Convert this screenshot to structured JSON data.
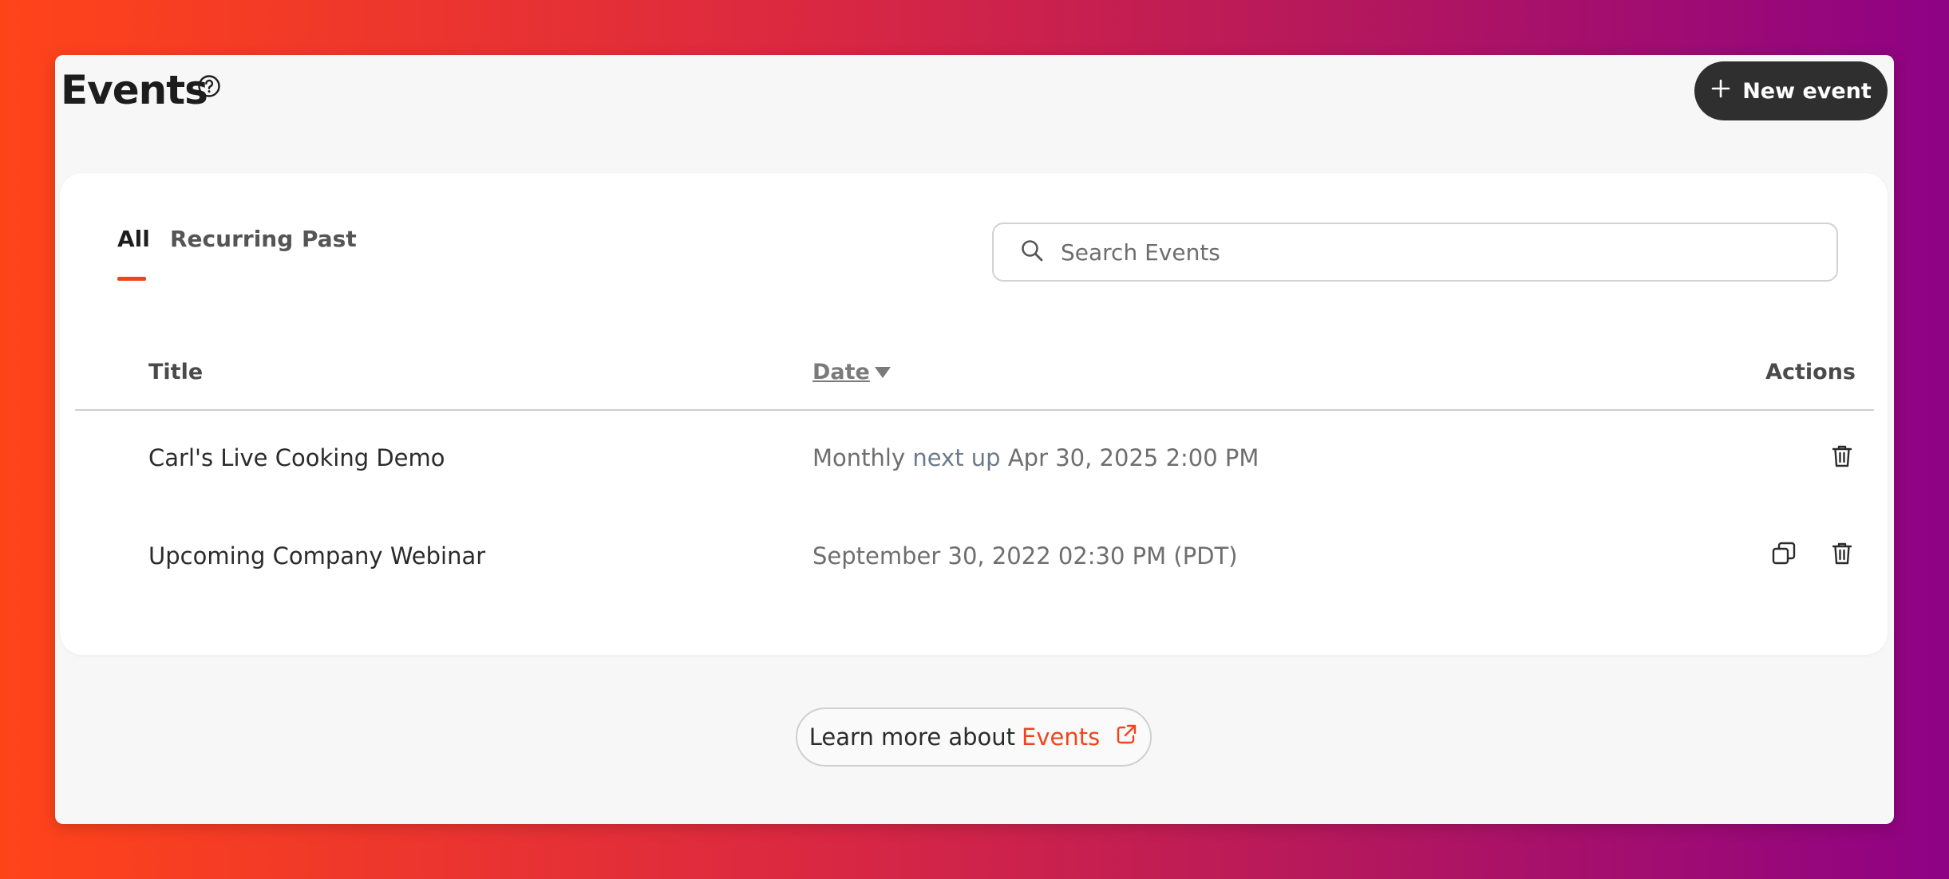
{
  "page": {
    "title": "Events"
  },
  "toolbar": {
    "new_event_label": "New event"
  },
  "tabs": [
    {
      "label": "All",
      "active": true
    },
    {
      "label": "Recurring",
      "active": false
    },
    {
      "label": "Past",
      "active": false
    }
  ],
  "search": {
    "placeholder": "Search Events",
    "value": ""
  },
  "table": {
    "columns": {
      "title": "Title",
      "date": "Date",
      "actions": "Actions"
    },
    "sort": {
      "column": "date",
      "direction": "descending"
    },
    "rows": [
      {
        "title": "Carl's Live Cooking Demo",
        "date_prefix": "Monthly",
        "date_next": "next up",
        "date_value": "Apr 30, 2025 2:00 PM",
        "actions": [
          "delete"
        ]
      },
      {
        "title": "Upcoming Company Webinar",
        "date_prefix": "",
        "date_next": "",
        "date_value": "September 30, 2022 02:30 PM (PDT)",
        "actions": [
          "duplicate",
          "delete"
        ]
      }
    ]
  },
  "footer": {
    "learn_more_prefix": "Learn more about",
    "learn_more_link": "Events"
  },
  "colors": {
    "accent": "#f2441c",
    "button_dark": "#2f2f2f",
    "background_gradient_start": "#ff4419",
    "background_gradient_end": "#8e0284"
  },
  "icons": {
    "help": "help-circle-icon",
    "add": "plus-icon",
    "search": "search-icon",
    "delete": "trash-icon",
    "duplicate": "copy-icon",
    "external": "external-link-icon"
  }
}
